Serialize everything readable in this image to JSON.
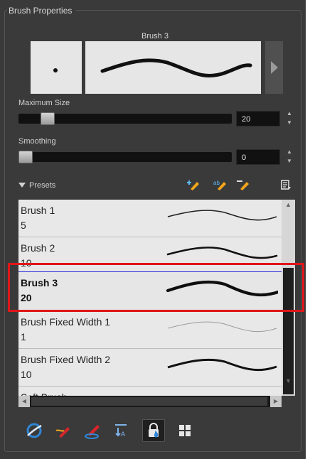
{
  "panel": {
    "title": "Brush Properties"
  },
  "brush_preview": {
    "name": "Brush 3",
    "next_icon": "play-arrow-icon"
  },
  "maximum_size": {
    "label": "Maximum Size",
    "value": "20",
    "slider_level": 0.11
  },
  "smoothing": {
    "label": "Smoothing",
    "value": "0",
    "slider_level": 0.0
  },
  "presets": {
    "label": "Presets",
    "toolbar_icons": [
      "new-brush-icon",
      "rename-brush-icon",
      "delete-brush-icon",
      "presets-menu-icon"
    ],
    "items": [
      {
        "name": "Brush 1",
        "size": "5"
      },
      {
        "name": "Brush 2",
        "size": "10"
      },
      {
        "name": "Brush 3",
        "size": "20",
        "selected": true
      },
      {
        "name": "Brush Fixed Width 1",
        "size": "1"
      },
      {
        "name": "Brush Fixed Width 2",
        "size": "10"
      },
      {
        "name": "Soft Brush",
        "size": ""
      }
    ]
  },
  "bottom_tools": [
    "auto-flatten-icon",
    "draw-behind-icon",
    "auto-close-gap-icon",
    "respect-pressure-icon",
    "lock-color-icon",
    "grid-view-icon"
  ],
  "colors": {
    "panel_bg": "#3a3a3a",
    "selection_highlight": "#e0161a",
    "selection_line": "#2b2bd8",
    "accent_orange": "#f2a51c",
    "accent_red": "#d9262c",
    "accent_blue": "#2f86d6"
  }
}
